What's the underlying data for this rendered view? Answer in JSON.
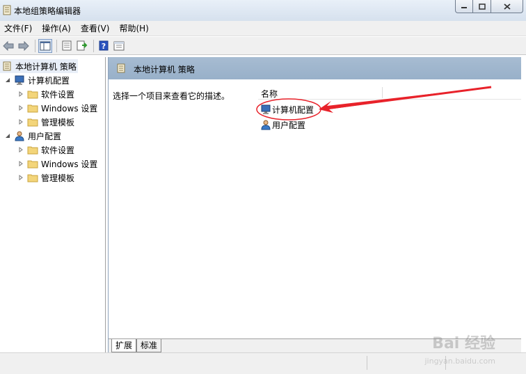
{
  "window": {
    "title": "本地组策略编辑器"
  },
  "menu": [
    "文件(F)",
    "操作(A)",
    "查看(V)",
    "帮助(H)"
  ],
  "toolbar": {
    "icons": [
      "back-icon",
      "forward-icon",
      "show-hide-tree-icon",
      "properties-icon",
      "export-list-icon",
      "help-icon",
      "extended-view-icon"
    ]
  },
  "tree": {
    "root": "本地计算机 策略",
    "computer": "计算机配置",
    "computer_children": [
      "软件设置",
      "Windows 设置",
      "管理模板"
    ],
    "user": "用户配置",
    "user_children": [
      "软件设置",
      "Windows 设置",
      "管理模板"
    ]
  },
  "panel": {
    "title": "本地计算机 策略",
    "description": "选择一个项目来查看它的描述。",
    "column_name": "名称",
    "items": [
      "计算机配置",
      "用户配置"
    ]
  },
  "tabs": [
    "扩展",
    "标准"
  ],
  "watermark": {
    "brand": "Bai 经验",
    "url": "jingyan.baidu.com"
  },
  "colors": {
    "header": "#a7bcd2",
    "annotation": "#e8222a"
  }
}
